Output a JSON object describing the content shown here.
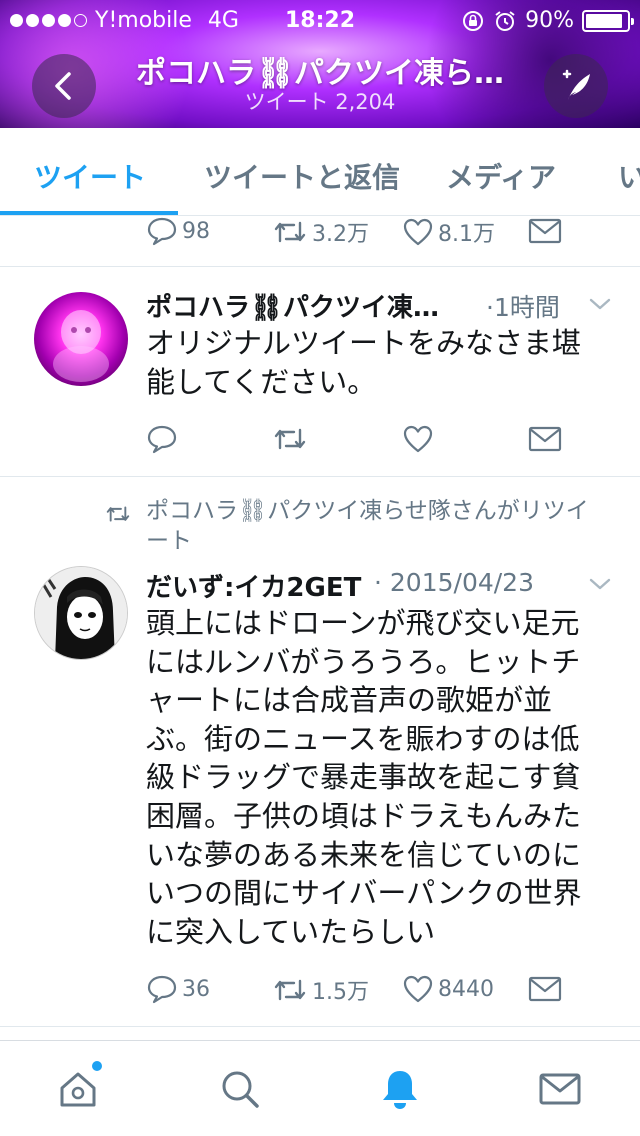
{
  "status_bar": {
    "carrier": "Y!mobile",
    "network": "4G",
    "time": "18:22",
    "battery": "90%",
    "battery_level": 0.9,
    "signal_bars": 4
  },
  "header": {
    "title": "ポコハラ⛓パクツイ凍ら…",
    "subtitle": "ツイート 2,204",
    "back_icon": "chevron-left-icon",
    "compose_icon": "compose-feather-icon"
  },
  "tabs": [
    {
      "label": "ツイート",
      "active": true
    },
    {
      "label": "ツイートと返信",
      "active": false
    },
    {
      "label": "メディア",
      "active": false
    },
    {
      "label": "い",
      "active": false
    }
  ],
  "tweets": [
    {
      "partial": true,
      "actions": {
        "replies": "98",
        "retweets": "3.2万",
        "likes": "8.1万"
      }
    },
    {
      "author": "ポコハラ⛓パクツイ凍…",
      "time": "·1時間",
      "text": "オリジナルツイートをみなさま堪能してください。",
      "actions": {
        "replies": "",
        "retweets": "",
        "likes": ""
      }
    },
    {
      "retweeted_by": "ポコハラ⛓パクツイ凍らせ隊さんがリツイート",
      "author": "だいず:イカ2GET",
      "time": "· 2015/04/23",
      "text": "頭上にはドローンが飛び交い足元にはルンバがうろうろ。ヒットチャートには合成音声の歌姫が並ぶ。街のニュースを賑わすのは低級ドラッグで暴走事故を起こす貧困層。子供の頃はドラえもんみたいな夢のある未来を信じていのにいつの間にサイバーパンクの世界に突入していたらしい",
      "actions": {
        "replies": "36",
        "retweets": "1.5万",
        "likes": "8440"
      }
    }
  ],
  "bottom_nav": [
    {
      "icon": "home-icon",
      "active": false,
      "badge": true
    },
    {
      "icon": "search-icon",
      "active": false
    },
    {
      "icon": "bell-icon",
      "active": true
    },
    {
      "icon": "mail-icon",
      "active": false
    }
  ],
  "colors": {
    "accent": "#1da1f2",
    "text": "#14171a",
    "muted": "#657786",
    "header_purple": "#9a1ee6"
  }
}
